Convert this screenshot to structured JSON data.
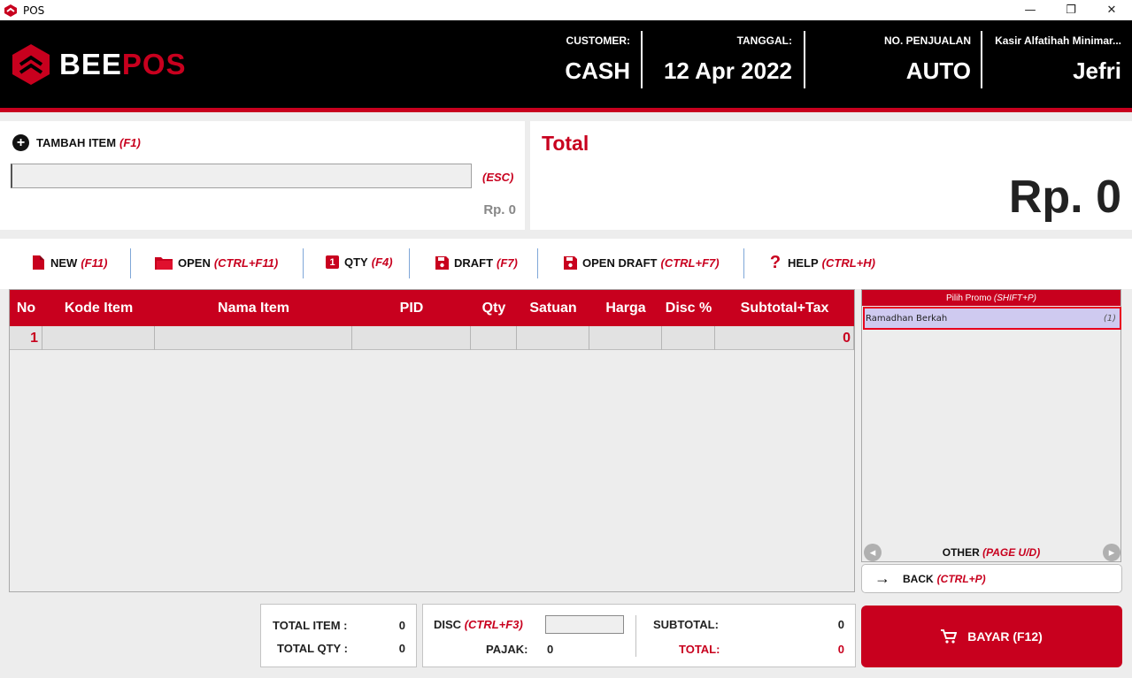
{
  "window": {
    "title": "POS",
    "minimize": "—",
    "restore": "❐",
    "close": "✕"
  },
  "brand": {
    "name_part1": "BEE",
    "name_part2": "POS",
    "accent": "#c8001e"
  },
  "header": {
    "customer_label": "CUSTOMER:",
    "customer_value": "CASH",
    "date_label": "TANGGAL:",
    "date_value": "12 Apr 2022",
    "sale_no_label": "NO. PENJUALAN",
    "sale_no_value": "AUTO",
    "cashier_label": "Kasir Alfatihah Minimar...",
    "cashier_value": "Jefri"
  },
  "add_item": {
    "label": "TAMBAH ITEM",
    "shortcut": "(F1)",
    "input_value": "",
    "esc_hint": "(ESC)",
    "price": "Rp. 0"
  },
  "total": {
    "label": "Total",
    "value": "Rp. 0"
  },
  "toolbar": [
    {
      "label": "NEW",
      "shortcut": "(F11)",
      "icon": "file-icon"
    },
    {
      "label": "OPEN",
      "shortcut": "(CTRL+F11)",
      "icon": "folder-icon"
    },
    {
      "label": "QTY",
      "shortcut": "(F4)",
      "icon": "qty-icon",
      "badge": "1"
    },
    {
      "label": "DRAFT",
      "shortcut": "(F7)",
      "icon": "save-icon"
    },
    {
      "label": "OPEN DRAFT",
      "shortcut": "(CTRL+F7)",
      "icon": "save-icon"
    },
    {
      "label": "HELP",
      "shortcut": "(CTRL+H)",
      "icon": "question-icon"
    }
  ],
  "table": {
    "columns": [
      "No",
      "Kode Item",
      "Nama Item",
      "PID",
      "Qty",
      "Satuan",
      "Harga",
      "Disc %",
      "Subtotal+Tax"
    ],
    "rows": [
      {
        "no": "1",
        "subtotal": "0"
      }
    ]
  },
  "promo": {
    "header": "Pilih Promo",
    "header_shortcut": "(SHIFT+P)",
    "items": [
      {
        "name": "Ramadhan Berkah",
        "count": "(1)"
      }
    ],
    "footer": "OTHER",
    "footer_shortcut": "(PAGE U/D)"
  },
  "back": {
    "label": "BACK",
    "shortcut": "(CTRL+P)"
  },
  "summary": {
    "total_item_label": "TOTAL ITEM :",
    "total_item_value": "0",
    "total_qty_label": "TOTAL QTY :",
    "total_qty_value": "0",
    "disc_label": "DISC",
    "disc_shortcut": "(CTRL+F3)",
    "tax_label": "PAJAK:",
    "tax_value": "0",
    "subtotal_label": "SUBTOTAL:",
    "subtotal_value": "0",
    "grand_total_label": "TOTAL:",
    "grand_total_value": "0"
  },
  "pay": {
    "label": "BAYAR (F12)"
  }
}
